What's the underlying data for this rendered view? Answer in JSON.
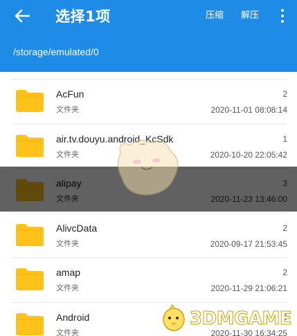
{
  "header": {
    "title": "选择1项",
    "compress_label": "压缩",
    "extract_label": "解压",
    "path": "/storage/emulated/0"
  },
  "colors": {
    "appbar": "#1e8be6",
    "folder": "#ffc21a"
  },
  "files": [
    {
      "name": "AcFun",
      "type": "文件夹",
      "count": "2",
      "date": "2020-11-01 08:08:14",
      "selected": false
    },
    {
      "name": "air.tv.douyu.android_KcSdk",
      "type": "文件夹",
      "count": "1",
      "date": "2020-10-20 22:05:42",
      "selected": false
    },
    {
      "name": "alipay",
      "type": "文件夹",
      "count": "3",
      "date": "2020-11-23 13:46:00",
      "selected": true
    },
    {
      "name": "AlivcData",
      "type": "文件夹",
      "count": "2",
      "date": "2020-09-17 21:53:45",
      "selected": false
    },
    {
      "name": "amap",
      "type": "文件夹",
      "count": "2",
      "date": "2020-11-29 21:06:21",
      "selected": false
    },
    {
      "name": "Android",
      "type": "文件夹",
      "count": "9",
      "date": "2020-11-30 16:34:25",
      "selected": false
    }
  ],
  "watermark": {
    "text": "3DMGAME"
  }
}
